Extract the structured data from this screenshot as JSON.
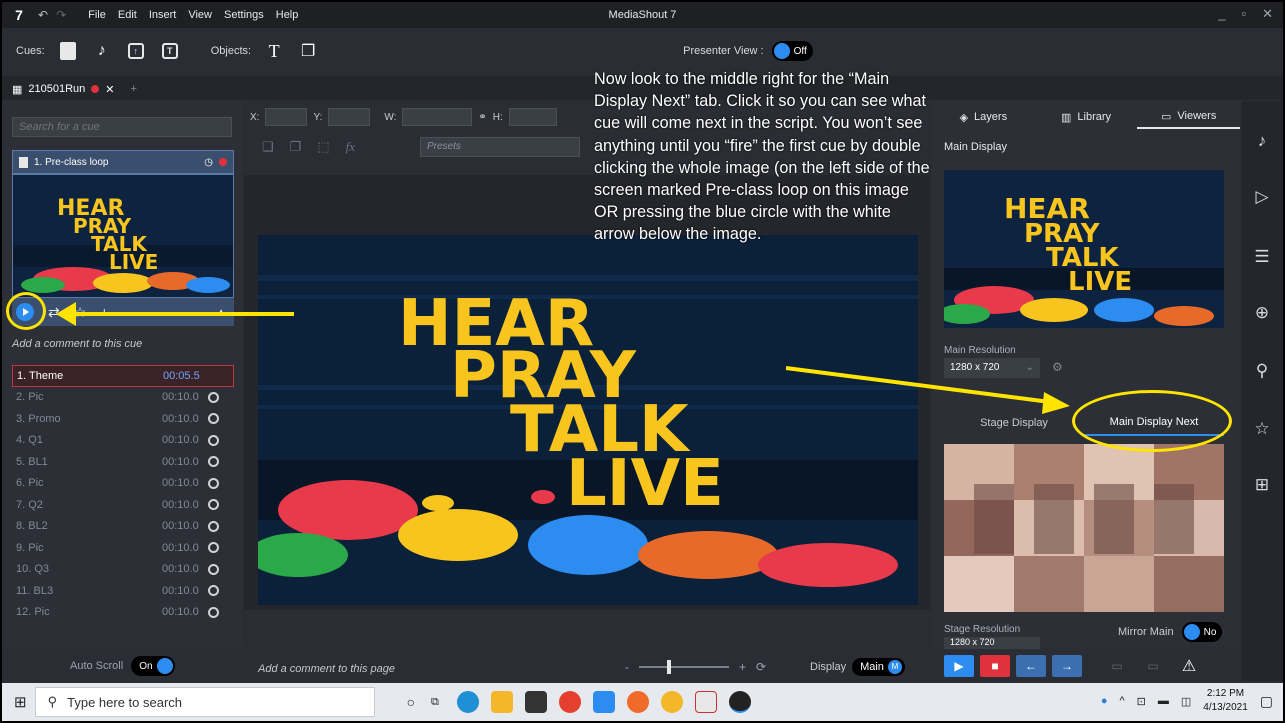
{
  "window": {
    "app_title": "MediaShout 7",
    "logo": "7",
    "menu": [
      "File",
      "Edit",
      "Insert",
      "View",
      "Settings",
      "Help"
    ]
  },
  "toolbar": {
    "cues_label": "Cues:",
    "objects_label": "Objects:",
    "presenter_view_label": "Presenter View :",
    "presenter_view_state": "Off"
  },
  "tab": {
    "name": "210501Run"
  },
  "left": {
    "search_placeholder": "Search for a cue",
    "cue_header": "1. Pre-class loop",
    "comment_placeholder": "Add a comment to this cue",
    "cues": [
      {
        "label": "1. Theme",
        "time": "00:05.5"
      },
      {
        "label": "2. Pic",
        "time": "00:10.0"
      },
      {
        "label": "3. Promo",
        "time": "00:10.0"
      },
      {
        "label": "4. Q1",
        "time": "00:10.0"
      },
      {
        "label": "5. BL1",
        "time": "00:10.0"
      },
      {
        "label": "6. Pic",
        "time": "00:10.0"
      },
      {
        "label": "7. Q2",
        "time": "00:10.0"
      },
      {
        "label": "8. BL2",
        "time": "00:10.0"
      },
      {
        "label": "9. Pic",
        "time": "00:10.0"
      },
      {
        "label": "10. Q3",
        "time": "00:10.0"
      },
      {
        "label": "11. BL3",
        "time": "00:10.0"
      },
      {
        "label": "12. Pic",
        "time": "00:10.0"
      }
    ],
    "auto_scroll_label": "Auto Scroll",
    "auto_scroll_state": "On"
  },
  "center": {
    "prop_x": "X:",
    "prop_y": "Y:",
    "prop_w": "W:",
    "prop_h": "H:",
    "fx": "fx",
    "presets_placeholder": "Presets",
    "page_comment_placeholder": "Add a comment to this page",
    "zoom_minus": "-",
    "zoom_plus": "+",
    "display_label": "Display",
    "display_value": "Main",
    "display_badge": "M"
  },
  "artwork": {
    "words": [
      "HEAR",
      "PRAY",
      "TALK",
      "LIVE"
    ]
  },
  "right": {
    "tabs": [
      "Layers",
      "Library",
      "Viewers"
    ],
    "main_display_label": "Main Display",
    "main_resolution_label": "Main Resolution",
    "main_resolution_value": "1280 x 720",
    "stage_tabs": [
      "Stage Display",
      "Main Display Next"
    ],
    "stage_resolution_label": "Stage Resolution",
    "stage_resolution_value": "1280 x 720",
    "mirror_label": "Mirror Main",
    "mirror_state": "No"
  },
  "annotation": {
    "text": "Now look to the middle right for the “Main Display Next” tab. Click it so you can see what cue will come next in the script. You won’t see anything until you “fire” the first cue by double clicking the whole image (on the left side of the screen marked Pre-class loop on this image OR pressing the blue circle with the white arrow below the image.",
    "color": "#ffe400"
  },
  "taskbar": {
    "search_placeholder": "Type here to search",
    "time": "2:12 PM",
    "date": "4/13/2021"
  },
  "colors": {
    "accent": "#2d8cf0",
    "stop": "#e0323c",
    "highlight": "#ffe400"
  }
}
